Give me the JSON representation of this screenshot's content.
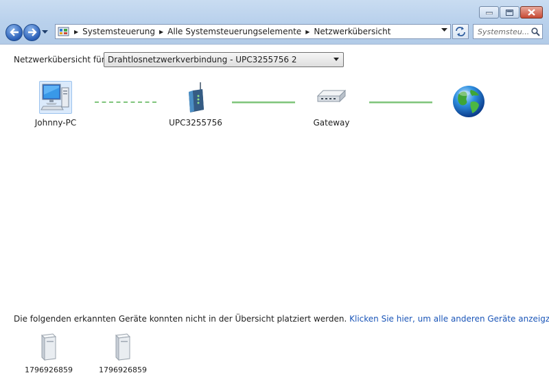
{
  "window": {
    "controls": {
      "minimize": "minimize",
      "maximize": "maximize",
      "close": "close"
    }
  },
  "nav": {
    "back_icon": "back-arrow-icon",
    "forward_icon": "forward-arrow-icon",
    "history_icon": "chevron-down-icon"
  },
  "address": {
    "icon": "control-panel-icon",
    "breadcrumbs": [
      "Systemsteuerung",
      "Alle Systemsteuerungselemente",
      "Netzwerkübersicht"
    ]
  },
  "search": {
    "placeholder": "Systemsteu..."
  },
  "overview": {
    "label": "Netzwerkübersicht für",
    "selected_connection": "Drahtlosnetzwerkverbindung - UPC3255756  2"
  },
  "map": {
    "nodes": [
      {
        "label": "Johnny-PC",
        "icon": "computer-icon"
      },
      {
        "label": "UPC3255756",
        "icon": "wireless-router-icon"
      },
      {
        "label": "Gateway",
        "icon": "gateway-icon"
      },
      {
        "label": "",
        "icon": "internet-globe-icon"
      }
    ],
    "links": [
      {
        "style": "dashed",
        "meaning": "wireless"
      },
      {
        "style": "solid",
        "meaning": "wired"
      },
      {
        "style": "solid",
        "meaning": "wired"
      }
    ],
    "line_color": "#7fc47b"
  },
  "unplaced": {
    "text": "Die folgenden erkannten Geräte konnten nicht in der Übersicht platziert werden.",
    "link": "Klicken Sie hier, um alle anderen Geräte anzeigzt zu bekommen.",
    "devices": [
      {
        "label": "1796926859",
        "icon": "network-device-icon"
      },
      {
        "label": "1796926859",
        "icon": "network-device-icon"
      }
    ]
  },
  "colors": {
    "link": "#1a55b8",
    "chrome": "#c9dcf1"
  }
}
